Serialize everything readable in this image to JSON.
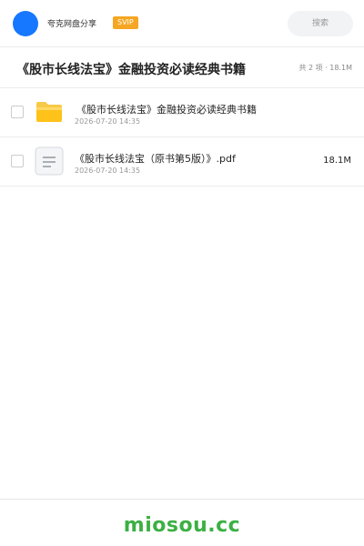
{
  "header": {
    "share_name": "夸克网盘分享",
    "badge": "SVIP",
    "search_placeholder": "搜索",
    "avatar_color": "#1677ff",
    "badge_color": "#f5a623"
  },
  "folder": {
    "title": "《股市长线法宝》金融投资必读经典书籍",
    "meta": "共 2 项 · 18.1M"
  },
  "files": [
    {
      "icon": "folder-icon",
      "name": "《股市长线法宝》金融投资必读经典书籍",
      "date": "2026-07-20 14:35",
      "size": ""
    },
    {
      "icon": "document-icon",
      "name": "《股市长线法宝（原书第5版）》.pdf",
      "date": "2026-07-20 14:35",
      "size": "18.1M"
    }
  ],
  "footer": {
    "brand": "miosou.cc",
    "brand_color": "#3cb043"
  }
}
